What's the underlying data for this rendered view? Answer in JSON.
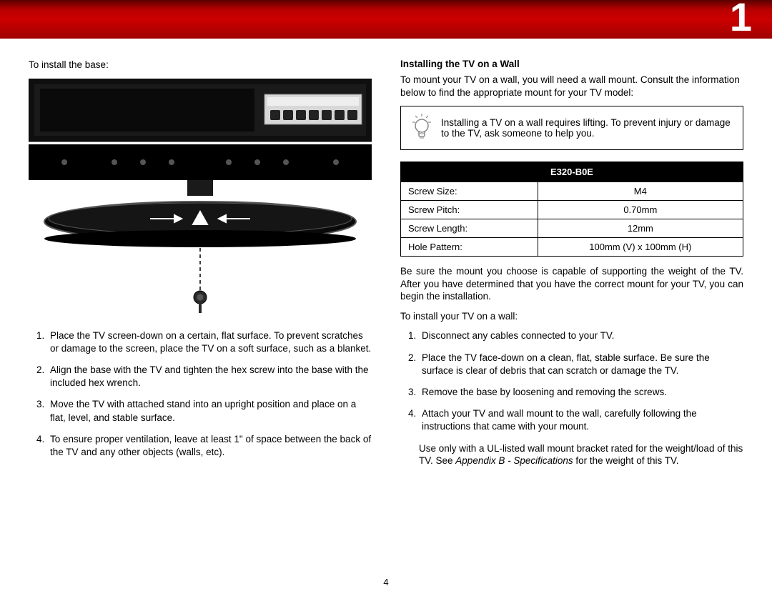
{
  "header": {
    "page_marker": "1"
  },
  "left": {
    "intro": "To install the base:",
    "steps": [
      "Place the TV screen-down on a certain, flat surface. To prevent scratches or damage to the screen, place the TV on a soft surface, such as a blanket.",
      "Align the base with the TV and tighten the hex screw into the base with the included hex wrench.",
      "Move the TV with attached stand into an upright position and place on a flat, level, and stable surface.",
      "To ensure proper ventilation, leave at least 1\" of space between the back of the TV and any other objects (walls, etc)."
    ]
  },
  "right": {
    "heading": "Installing the TV on a Wall",
    "intro": "To mount your TV on a wall, you will need a wall mount. Consult the information below to find the appropriate mount for your TV model:",
    "tip": "Installing a TV on a wall requires lifting. To prevent injury or damage to the TV, ask someone to help you.",
    "table": {
      "header": "E320-B0E",
      "rows": [
        {
          "label": "Screw Size:",
          "value": "M4"
        },
        {
          "label": "Screw Pitch:",
          "value": "0.70mm"
        },
        {
          "label": "Screw Length:",
          "value": "12mm"
        },
        {
          "label": "Hole Pattern:",
          "value": "100mm (V) x 100mm (H)"
        }
      ]
    },
    "after_table": "Be sure the mount you choose is capable of supporting the weight of the TV. After you have determined that you have the correct mount for your TV, you can begin the installation.",
    "list_intro": "To install your TV on a wall:",
    "steps": [
      "Disconnect any cables connected to your TV.",
      "Place the TV face-down on a clean, flat, stable surface. Be sure the surface is clear of debris that can scratch or damage the TV.",
      "Remove the base by loosening and removing the screws.",
      "Attach your TV and wall mount to the wall, carefully following the instructions that came with your mount."
    ],
    "closing_pre": "Use only with a UL-listed wall mount bracket rated for the weight/load of this TV. See ",
    "closing_italic": "Appendix B - Specifications",
    "closing_post": " for the weight of this TV."
  },
  "footer": {
    "page_number": "4"
  }
}
